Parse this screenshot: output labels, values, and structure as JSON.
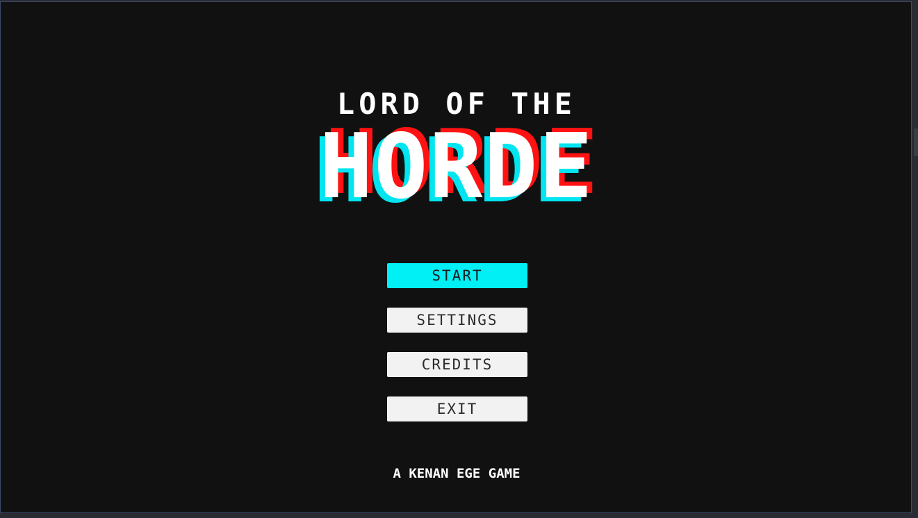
{
  "game": {
    "title_top": "LORD OF THE",
    "title_main": "HORDE",
    "credit_line": "A KENAN EGE GAME"
  },
  "menu": {
    "items": [
      {
        "label": "START",
        "selected": true
      },
      {
        "label": "SETTINGS",
        "selected": false
      },
      {
        "label": "CREDITS",
        "selected": false
      },
      {
        "label": "EXIT",
        "selected": false
      }
    ]
  },
  "colors": {
    "background": "#111111",
    "accent_cyan": "#00f0f5",
    "accent_red": "#ff1212",
    "button_bg": "#f2f2f2",
    "text_white": "#ffffff"
  }
}
